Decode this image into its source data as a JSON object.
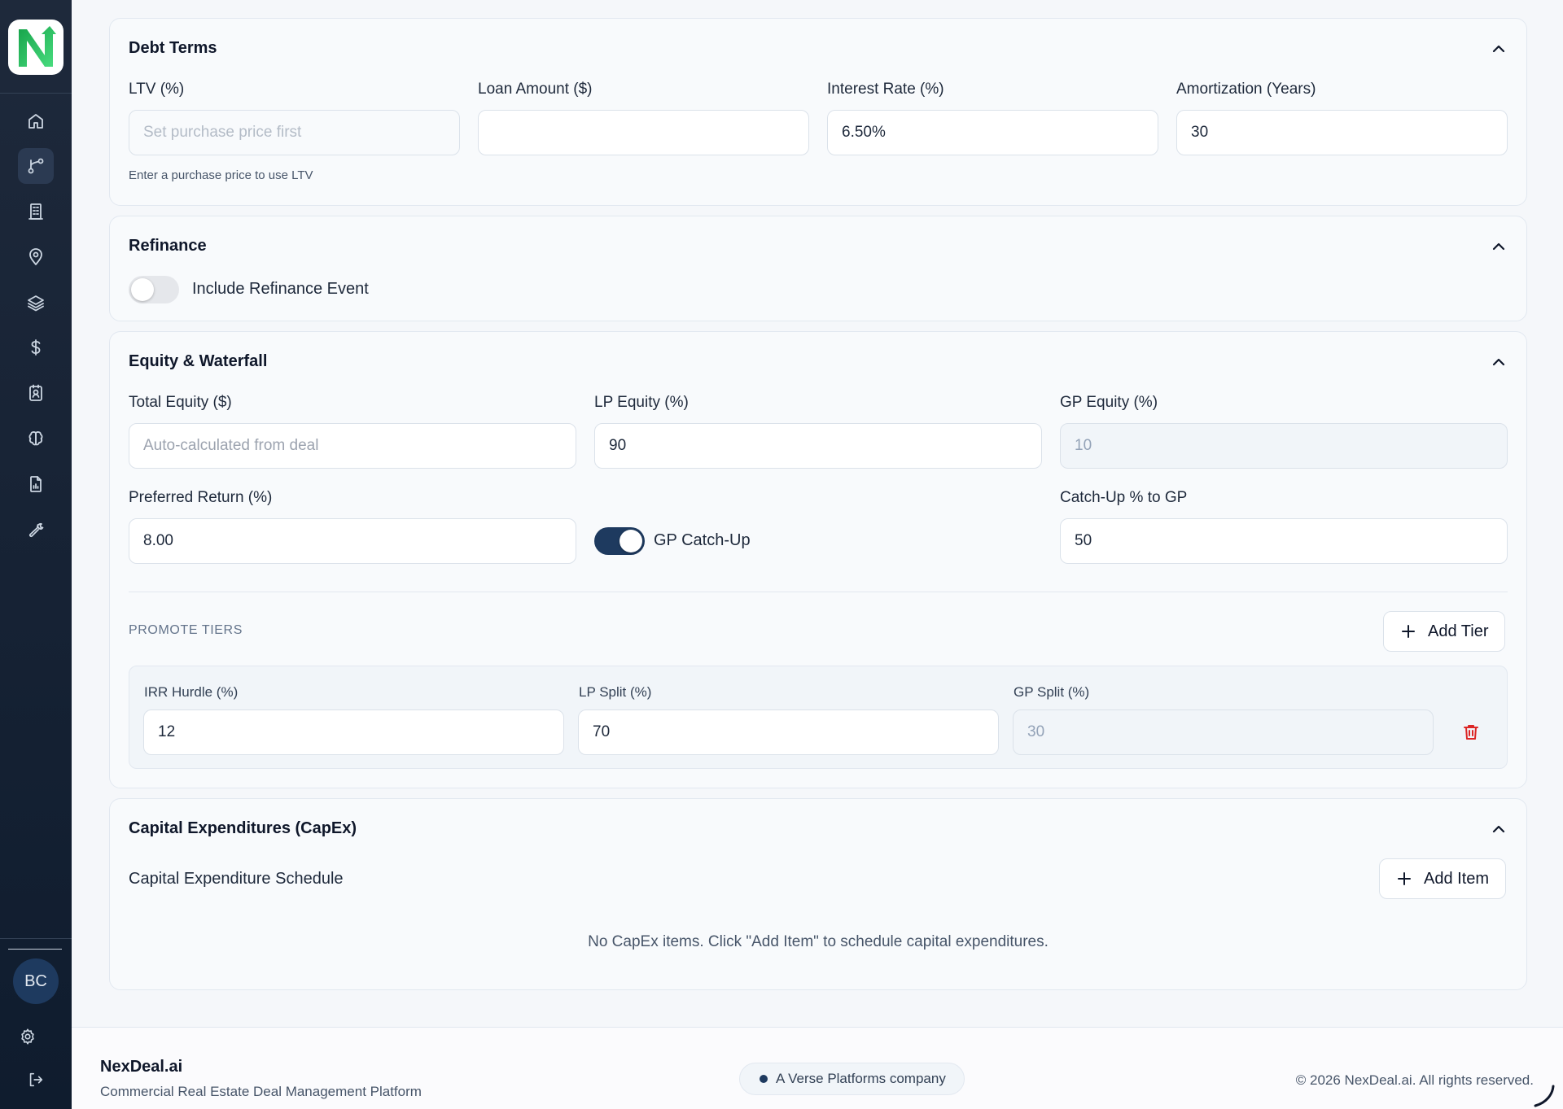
{
  "sidebar": {
    "logo_letter": "N",
    "nav": [
      {
        "name": "home-icon"
      },
      {
        "name": "branch-icon",
        "active": true
      },
      {
        "name": "building-icon"
      },
      {
        "name": "map-pin-icon"
      },
      {
        "name": "layers-icon"
      },
      {
        "name": "dollar-icon"
      },
      {
        "name": "contact-icon"
      },
      {
        "name": "brain-icon"
      },
      {
        "name": "report-icon"
      },
      {
        "name": "wrench-icon"
      }
    ],
    "avatar_initials": "BC"
  },
  "debt_terms": {
    "title": "Debt Terms",
    "ltv_label": "LTV (%)",
    "ltv_placeholder": "Set purchase price first",
    "loan_amount_label": "Loan Amount ($)",
    "loan_amount_value": "",
    "interest_rate_label": "Interest Rate (%)",
    "interest_rate_value": "6.50%",
    "amortization_label": "Amortization (Years)",
    "amortization_value": "30",
    "ltv_hint": "Enter a purchase price to use LTV"
  },
  "refinance": {
    "title": "Refinance",
    "toggle_label": "Include Refinance Event",
    "toggle_on": false
  },
  "equity": {
    "title": "Equity & Waterfall",
    "total_equity_label": "Total Equity ($)",
    "total_equity_placeholder": "Auto-calculated from deal",
    "lp_equity_label": "LP Equity (%)",
    "lp_equity_value": "90",
    "gp_equity_label": "GP Equity (%)",
    "gp_equity_value": "10",
    "pref_return_label": "Preferred Return (%)",
    "pref_return_value": "8.00",
    "gp_catchup_label": "GP Catch-Up",
    "gp_catchup_on": true,
    "catchup_label": "Catch-Up % to GP",
    "catchup_value": "50",
    "promote_caption": "PROMOTE TIERS",
    "add_tier_label": "Add Tier",
    "tiers": [
      {
        "irr_label": "IRR Hurdle (%)",
        "irr_value": "12",
        "lp_label": "LP Split (%)",
        "lp_value": "70",
        "gp_label": "GP Split (%)",
        "gp_value": "30"
      }
    ]
  },
  "capex": {
    "title": "Capital Expenditures (CapEx)",
    "schedule_label": "Capital Expenditure Schedule",
    "add_item_label": "Add Item",
    "empty_message": "No CapEx items. Click \"Add Item\" to schedule capital expenditures."
  },
  "footer": {
    "brand": "NexDeal.ai",
    "tagline": "Commercial Real Estate Deal Management Platform",
    "company_pill": "A Verse Platforms company",
    "copyright": "© 2026 NexDeal.ai. All rights reserved."
  },
  "colors": {
    "sidebar_bg": "#1e293b",
    "accent": "#1e3a5f",
    "logo_green": "#22c55e",
    "danger": "#dc2626"
  }
}
